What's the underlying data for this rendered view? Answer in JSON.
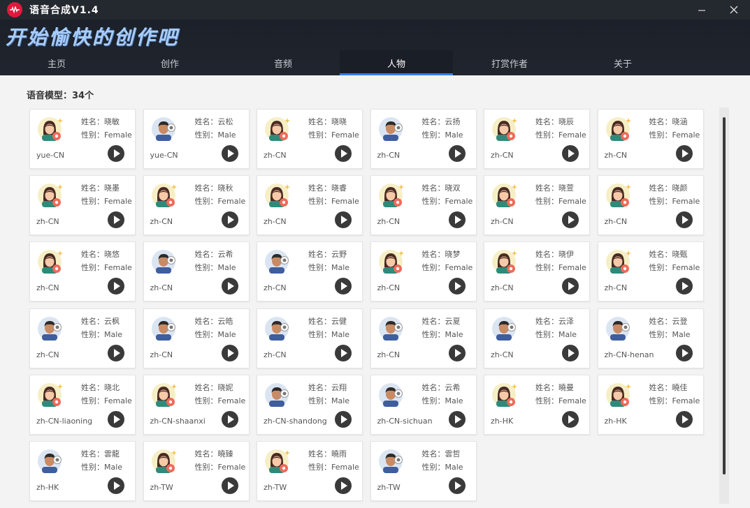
{
  "window": {
    "title": "语音合成V1.4",
    "minimize_symbol": "—",
    "close_symbol": "✕"
  },
  "header": {
    "slogan": "开始愉快的创作吧"
  },
  "tabs": [
    {
      "label": "主页",
      "active": false
    },
    {
      "label": "创作",
      "active": false
    },
    {
      "label": "音频",
      "active": false
    },
    {
      "label": "人物",
      "active": true
    },
    {
      "label": "打赏作者",
      "active": false
    },
    {
      "label": "关于",
      "active": false
    }
  ],
  "models": {
    "count_label": "语音模型：34个",
    "name_prefix": "姓名：",
    "gender_prefix": "性别：",
    "items": [
      {
        "name": "晓敏",
        "gender": "Female",
        "locale": "yue-CN"
      },
      {
        "name": "云松",
        "gender": "Male",
        "locale": "yue-CN"
      },
      {
        "name": "晓晓",
        "gender": "Female",
        "locale": "zh-CN"
      },
      {
        "name": "云扬",
        "gender": "Male",
        "locale": "zh-CN"
      },
      {
        "name": "晓辰",
        "gender": "Female",
        "locale": "zh-CN"
      },
      {
        "name": "晓涵",
        "gender": "Female",
        "locale": "zh-CN"
      },
      {
        "name": "晓墨",
        "gender": "Female",
        "locale": "zh-CN"
      },
      {
        "name": "晓秋",
        "gender": "Female",
        "locale": "zh-CN"
      },
      {
        "name": "晓睿",
        "gender": "Female",
        "locale": "zh-CN"
      },
      {
        "name": "晓双",
        "gender": "Female",
        "locale": "zh-CN"
      },
      {
        "name": "晓萱",
        "gender": "Female",
        "locale": "zh-CN"
      },
      {
        "name": "晓颜",
        "gender": "Female",
        "locale": "zh-CN"
      },
      {
        "name": "晓悠",
        "gender": "Female",
        "locale": "zh-CN"
      },
      {
        "name": "云希",
        "gender": "Male",
        "locale": "zh-CN"
      },
      {
        "name": "云野",
        "gender": "Male",
        "locale": "zh-CN"
      },
      {
        "name": "晓梦",
        "gender": "Female",
        "locale": "zh-CN"
      },
      {
        "name": "晓伊",
        "gender": "Female",
        "locale": "zh-CN"
      },
      {
        "name": "晓甄",
        "gender": "Female",
        "locale": "zh-CN"
      },
      {
        "name": "云枫",
        "gender": "Male",
        "locale": "zh-CN"
      },
      {
        "name": "云皓",
        "gender": "Male",
        "locale": "zh-CN"
      },
      {
        "name": "云健",
        "gender": "Male",
        "locale": "zh-CN"
      },
      {
        "name": "云夏",
        "gender": "Male",
        "locale": "zh-CN"
      },
      {
        "name": "云泽",
        "gender": "Male",
        "locale": "zh-CN"
      },
      {
        "name": "云登",
        "gender": "Male",
        "locale": "zh-CN-henan"
      },
      {
        "name": "晓北",
        "gender": "Female",
        "locale": "zh-CN-liaoning"
      },
      {
        "name": "晓妮",
        "gender": "Female",
        "locale": "zh-CN-shaanxi"
      },
      {
        "name": "云翔",
        "gender": "Male",
        "locale": "zh-CN-shandong"
      },
      {
        "name": "云希",
        "gender": "Male",
        "locale": "zh-CN-sichuan"
      },
      {
        "name": "曉曼",
        "gender": "Female",
        "locale": "zh-HK"
      },
      {
        "name": "曉佳",
        "gender": "Female",
        "locale": "zh-HK"
      },
      {
        "name": "雲龍",
        "gender": "Male",
        "locale": "zh-HK"
      },
      {
        "name": "曉臻",
        "gender": "Female",
        "locale": "zh-TW"
      },
      {
        "name": "曉雨",
        "gender": "Female",
        "locale": "zh-TW"
      },
      {
        "name": "雲哲",
        "gender": "Male",
        "locale": "zh-TW"
      }
    ]
  },
  "colors": {
    "accent": "#2f7ff0",
    "titlebar": "#24282f",
    "header": "#1b2029",
    "slogan": "#a8cdfb",
    "app_icon": "#e0193c"
  }
}
